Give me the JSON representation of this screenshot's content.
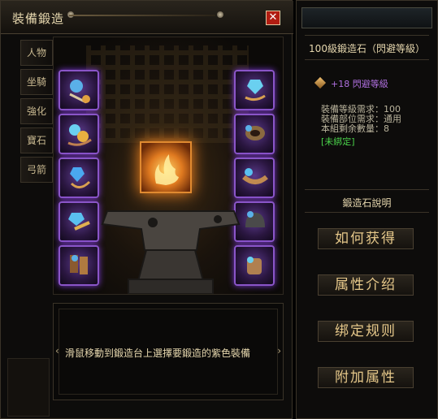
{
  "window": {
    "title": "裝備鍛造",
    "close_icon": "close-icon"
  },
  "tabs": [
    {
      "label": "人物"
    },
    {
      "label": "坐騎"
    },
    {
      "label": "強化"
    },
    {
      "label": "寶石"
    },
    {
      "label": "弓箭"
    }
  ],
  "forge": {
    "hint": "滑鼠移動到鍛造台上選擇要鍛造的紫色裝備",
    "slot_border_color": "#8a55c8"
  },
  "item": {
    "name": "100級鍛造石（閃避等級）",
    "attribute": "+18 閃避等級",
    "requirements": [
      "裝備等級需求：100",
      "裝備部位需求：通用",
      "本組剩余數量：8"
    ],
    "bind_status": "[未綁定]"
  },
  "panel": {
    "desc_title": "鍛造石說明",
    "buttons": [
      {
        "label": "如何获得"
      },
      {
        "label": "属性介绍"
      },
      {
        "label": "绑定规则"
      },
      {
        "label": "附加属性"
      }
    ]
  }
}
